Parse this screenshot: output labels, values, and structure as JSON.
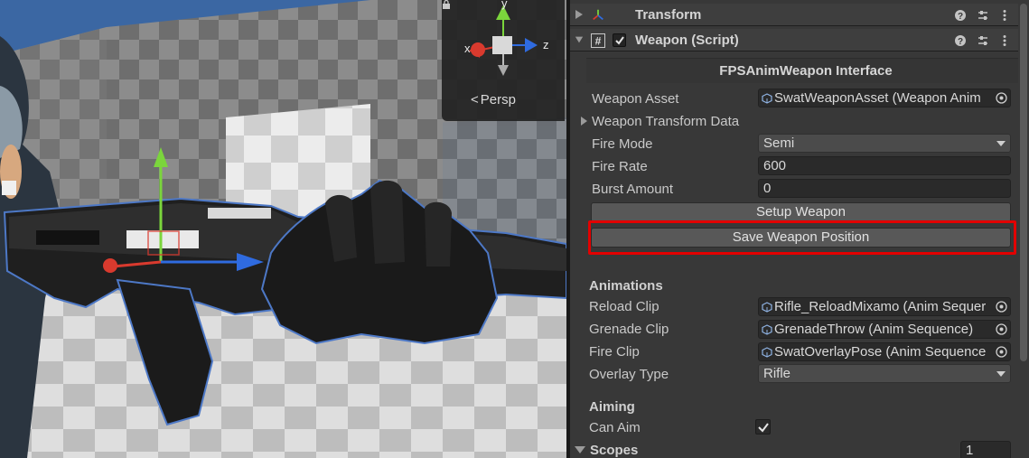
{
  "scene": {
    "persp_label": "Persp",
    "gizmo_axes": {
      "y": "y",
      "x": "x",
      "z": "z"
    },
    "colors": {
      "y_axis": "#7bd53c",
      "x_axis": "#d93a2e",
      "z_axis": "#2f6be0",
      "selection_outline": "#4d78c6"
    }
  },
  "inspector": {
    "transform_header": {
      "title": "Transform",
      "icon": "transform-axes-icon"
    },
    "weapon_header": {
      "title": "Weapon (Script)",
      "icon": "csharp-script-icon",
      "enabled": true
    },
    "interface_title": "FPSAnimWeapon Interface",
    "fields": {
      "weapon_asset": {
        "label": "Weapon Asset",
        "value": "SwatWeaponAsset (Weapon Anim"
      },
      "weapon_transform_data": {
        "label": "Weapon Transform Data"
      },
      "fire_mode": {
        "label": "Fire Mode",
        "value": "Semi"
      },
      "fire_rate": {
        "label": "Fire Rate",
        "value": "600"
      },
      "burst_amount": {
        "label": "Burst Amount",
        "value": "0"
      }
    },
    "buttons": {
      "setup_weapon": "Setup Weapon",
      "save_weapon_position": "Save Weapon Position"
    },
    "highlight_color": "#e30000",
    "animations": {
      "header": "Animations",
      "reload_clip": {
        "label": "Reload Clip",
        "value": "Rifle_ReloadMixamo (Anim Sequer"
      },
      "grenade_clip": {
        "label": "Grenade Clip",
        "value": "GrenadeThrow (Anim Sequence)"
      },
      "fire_clip": {
        "label": "Fire Clip",
        "value": "SwatOverlayPose (Anim Sequence"
      },
      "overlay_type": {
        "label": "Overlay Type",
        "value": "Rifle"
      }
    },
    "aiming": {
      "header": "Aiming",
      "can_aim": {
        "label": "Can Aim",
        "checked": true
      },
      "scopes": {
        "label": "Scopes",
        "count": "1"
      }
    }
  }
}
